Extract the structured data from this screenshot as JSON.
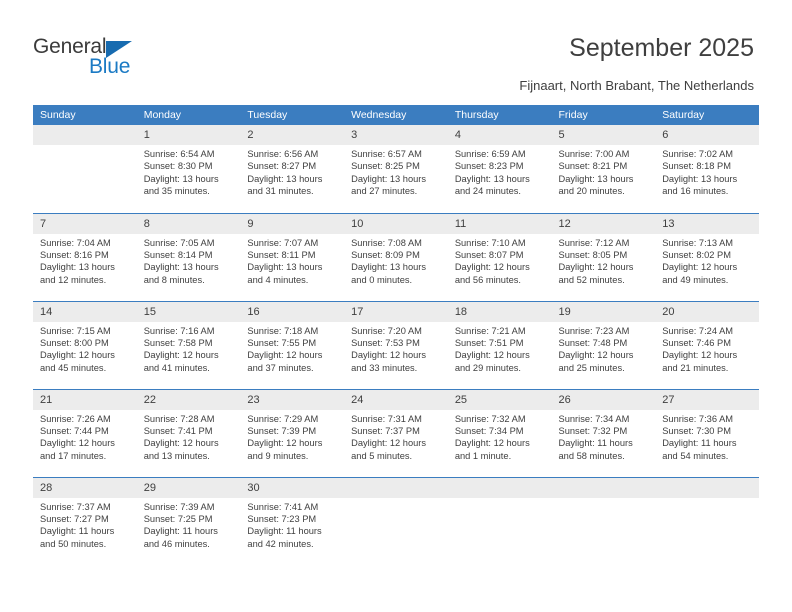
{
  "logo": {
    "primary_text": "General",
    "secondary_text": "Blue",
    "primary_color": "#3b3b3b",
    "secondary_color": "#1b7ac4",
    "triangle_color": "#176bb0"
  },
  "header": {
    "title": "September 2025",
    "subtitle": "Fijnaart, North Brabant, The Netherlands"
  },
  "theme": {
    "header_bg": "#3b7dc0",
    "header_text": "#ffffff",
    "daynum_bg": "#ececec",
    "text": "#3f3f3f",
    "cell_bg": "#ffffff"
  },
  "calendar": {
    "weekday_headers": [
      "Sunday",
      "Monday",
      "Tuesday",
      "Wednesday",
      "Thursday",
      "Friday",
      "Saturday"
    ],
    "weeks": [
      [
        {
          "day": "",
          "blank": true,
          "sunrise": "",
          "sunset": "",
          "daylight": ""
        },
        {
          "day": "1",
          "sunrise": "Sunrise: 6:54 AM",
          "sunset": "Sunset: 8:30 PM",
          "daylight": "Daylight: 13 hours and 35 minutes."
        },
        {
          "day": "2",
          "sunrise": "Sunrise: 6:56 AM",
          "sunset": "Sunset: 8:27 PM",
          "daylight": "Daylight: 13 hours and 31 minutes."
        },
        {
          "day": "3",
          "sunrise": "Sunrise: 6:57 AM",
          "sunset": "Sunset: 8:25 PM",
          "daylight": "Daylight: 13 hours and 27 minutes."
        },
        {
          "day": "4",
          "sunrise": "Sunrise: 6:59 AM",
          "sunset": "Sunset: 8:23 PM",
          "daylight": "Daylight: 13 hours and 24 minutes."
        },
        {
          "day": "5",
          "sunrise": "Sunrise: 7:00 AM",
          "sunset": "Sunset: 8:21 PM",
          "daylight": "Daylight: 13 hours and 20 minutes."
        },
        {
          "day": "6",
          "sunrise": "Sunrise: 7:02 AM",
          "sunset": "Sunset: 8:18 PM",
          "daylight": "Daylight: 13 hours and 16 minutes."
        }
      ],
      [
        {
          "day": "7",
          "sunrise": "Sunrise: 7:04 AM",
          "sunset": "Sunset: 8:16 PM",
          "daylight": "Daylight: 13 hours and 12 minutes."
        },
        {
          "day": "8",
          "sunrise": "Sunrise: 7:05 AM",
          "sunset": "Sunset: 8:14 PM",
          "daylight": "Daylight: 13 hours and 8 minutes."
        },
        {
          "day": "9",
          "sunrise": "Sunrise: 7:07 AM",
          "sunset": "Sunset: 8:11 PM",
          "daylight": "Daylight: 13 hours and 4 minutes."
        },
        {
          "day": "10",
          "sunrise": "Sunrise: 7:08 AM",
          "sunset": "Sunset: 8:09 PM",
          "daylight": "Daylight: 13 hours and 0 minutes."
        },
        {
          "day": "11",
          "sunrise": "Sunrise: 7:10 AM",
          "sunset": "Sunset: 8:07 PM",
          "daylight": "Daylight: 12 hours and 56 minutes."
        },
        {
          "day": "12",
          "sunrise": "Sunrise: 7:12 AM",
          "sunset": "Sunset: 8:05 PM",
          "daylight": "Daylight: 12 hours and 52 minutes."
        },
        {
          "day": "13",
          "sunrise": "Sunrise: 7:13 AM",
          "sunset": "Sunset: 8:02 PM",
          "daylight": "Daylight: 12 hours and 49 minutes."
        }
      ],
      [
        {
          "day": "14",
          "sunrise": "Sunrise: 7:15 AM",
          "sunset": "Sunset: 8:00 PM",
          "daylight": "Daylight: 12 hours and 45 minutes."
        },
        {
          "day": "15",
          "sunrise": "Sunrise: 7:16 AM",
          "sunset": "Sunset: 7:58 PM",
          "daylight": "Daylight: 12 hours and 41 minutes."
        },
        {
          "day": "16",
          "sunrise": "Sunrise: 7:18 AM",
          "sunset": "Sunset: 7:55 PM",
          "daylight": "Daylight: 12 hours and 37 minutes."
        },
        {
          "day": "17",
          "sunrise": "Sunrise: 7:20 AM",
          "sunset": "Sunset: 7:53 PM",
          "daylight": "Daylight: 12 hours and 33 minutes."
        },
        {
          "day": "18",
          "sunrise": "Sunrise: 7:21 AM",
          "sunset": "Sunset: 7:51 PM",
          "daylight": "Daylight: 12 hours and 29 minutes."
        },
        {
          "day": "19",
          "sunrise": "Sunrise: 7:23 AM",
          "sunset": "Sunset: 7:48 PM",
          "daylight": "Daylight: 12 hours and 25 minutes."
        },
        {
          "day": "20",
          "sunrise": "Sunrise: 7:24 AM",
          "sunset": "Sunset: 7:46 PM",
          "daylight": "Daylight: 12 hours and 21 minutes."
        }
      ],
      [
        {
          "day": "21",
          "sunrise": "Sunrise: 7:26 AM",
          "sunset": "Sunset: 7:44 PM",
          "daylight": "Daylight: 12 hours and 17 minutes."
        },
        {
          "day": "22",
          "sunrise": "Sunrise: 7:28 AM",
          "sunset": "Sunset: 7:41 PM",
          "daylight": "Daylight: 12 hours and 13 minutes."
        },
        {
          "day": "23",
          "sunrise": "Sunrise: 7:29 AM",
          "sunset": "Sunset: 7:39 PM",
          "daylight": "Daylight: 12 hours and 9 minutes."
        },
        {
          "day": "24",
          "sunrise": "Sunrise: 7:31 AM",
          "sunset": "Sunset: 7:37 PM",
          "daylight": "Daylight: 12 hours and 5 minutes."
        },
        {
          "day": "25",
          "sunrise": "Sunrise: 7:32 AM",
          "sunset": "Sunset: 7:34 PM",
          "daylight": "Daylight: 12 hours and 1 minute."
        },
        {
          "day": "26",
          "sunrise": "Sunrise: 7:34 AM",
          "sunset": "Sunset: 7:32 PM",
          "daylight": "Daylight: 11 hours and 58 minutes."
        },
        {
          "day": "27",
          "sunrise": "Sunrise: 7:36 AM",
          "sunset": "Sunset: 7:30 PM",
          "daylight": "Daylight: 11 hours and 54 minutes."
        }
      ],
      [
        {
          "day": "28",
          "sunrise": "Sunrise: 7:37 AM",
          "sunset": "Sunset: 7:27 PM",
          "daylight": "Daylight: 11 hours and 50 minutes."
        },
        {
          "day": "29",
          "sunrise": "Sunrise: 7:39 AM",
          "sunset": "Sunset: 7:25 PM",
          "daylight": "Daylight: 11 hours and 46 minutes."
        },
        {
          "day": "30",
          "sunrise": "Sunrise: 7:41 AM",
          "sunset": "Sunset: 7:23 PM",
          "daylight": "Daylight: 11 hours and 42 minutes."
        },
        {
          "day": "",
          "blank": true,
          "sunrise": "",
          "sunset": "",
          "daylight": ""
        },
        {
          "day": "",
          "blank": true,
          "sunrise": "",
          "sunset": "",
          "daylight": ""
        },
        {
          "day": "",
          "blank": true,
          "sunrise": "",
          "sunset": "",
          "daylight": ""
        },
        {
          "day": "",
          "blank": true,
          "sunrise": "",
          "sunset": "",
          "daylight": ""
        }
      ]
    ]
  }
}
